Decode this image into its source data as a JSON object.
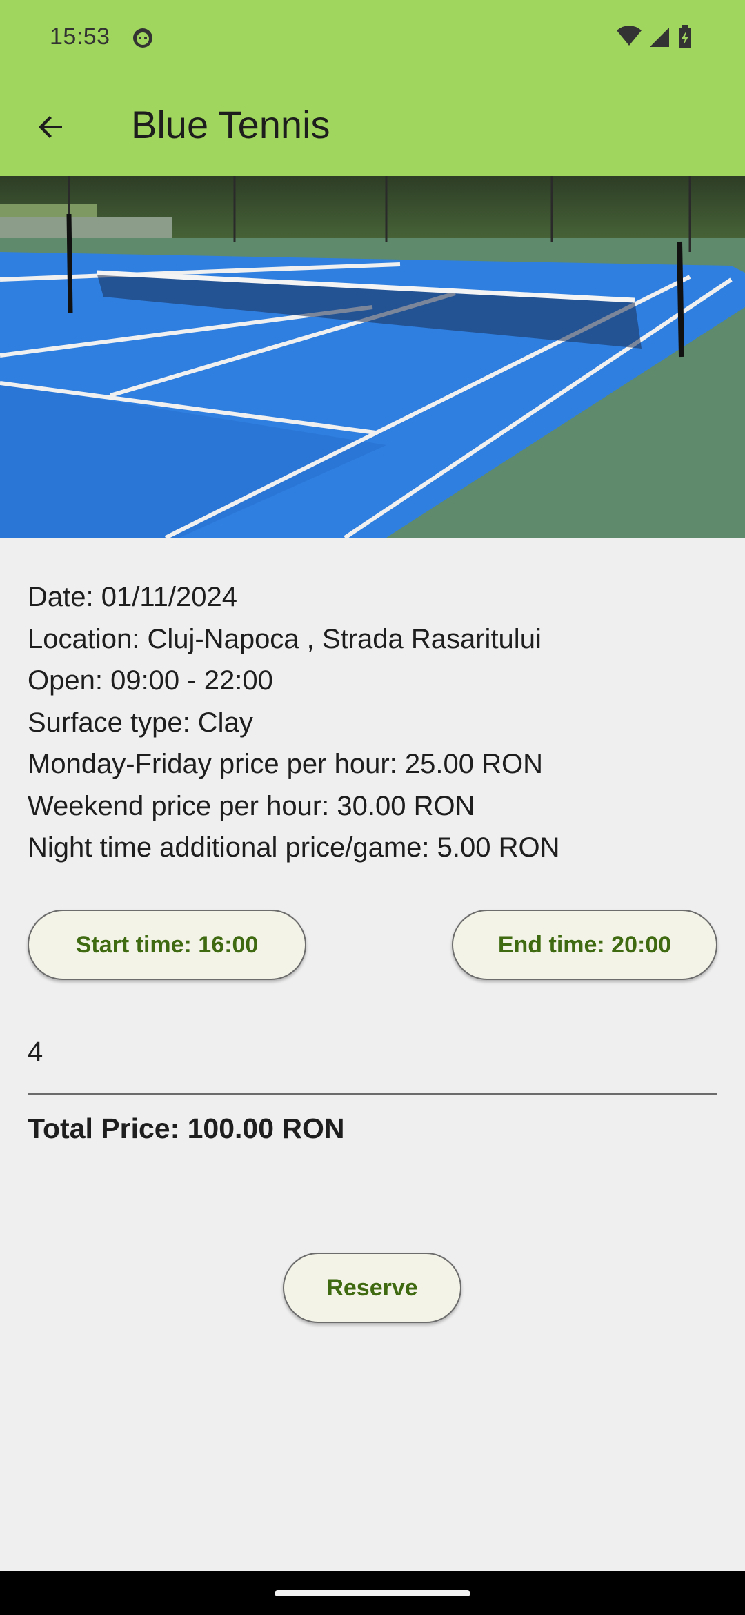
{
  "status_bar": {
    "time": "15:53"
  },
  "app_bar": {
    "title": "Blue Tennis"
  },
  "details": {
    "date": "Date: 01/11/2024",
    "location": "Location: Cluj-Napoca , Strada Rasaritului",
    "open": "Open: 09:00 - 22:00",
    "surface": "Surface type: Clay",
    "weekday_price": "Monday-Friday price per hour: 25.00 RON",
    "weekend_price": "Weekend price per hour: 30.00 RON",
    "night_price": "Night time additional price/game: 5.00 RON"
  },
  "buttons": {
    "start_time": "Start time: 16:00",
    "end_time": "End time: 20:00",
    "reserve": "Reserve"
  },
  "hours_field": {
    "value": "4"
  },
  "total_price": "Total Price: 100.00 RON",
  "colors": {
    "app_bar": "#a1d65e",
    "button_text": "#3f6a12",
    "button_bg": "#f3f3e7",
    "court_blue": "#2f7fe0",
    "court_surround": "#5f8a6c"
  },
  "icons": {
    "back": "arrow-left-icon",
    "status": [
      "face-icon",
      "wifi-icon",
      "signal-icon",
      "battery-charging-icon"
    ]
  }
}
